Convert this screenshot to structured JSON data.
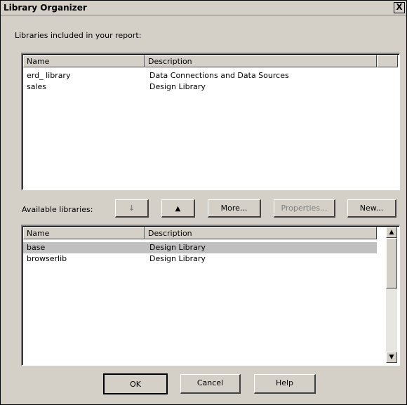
{
  "window": {
    "title": "Library Organizer",
    "close_glyph": "X"
  },
  "included": {
    "label": "Libraries included in your report:",
    "col_name": "Name",
    "col_desc": "Description",
    "rows": [
      {
        "name": "erd_ library",
        "desc": "Data Connections and Data Sources"
      },
      {
        "name": "sales",
        "desc": "Design Library"
      }
    ]
  },
  "available": {
    "label": "Available libraries:",
    "col_name": "Name",
    "col_desc": "Description",
    "rows": [
      {
        "name": "base",
        "desc": "Design Library",
        "selected": true
      },
      {
        "name": "browserlib",
        "desc": "Design Library",
        "selected": false
      }
    ]
  },
  "buttons": {
    "down_glyph": "↓",
    "up_glyph": "▲",
    "more": "More...",
    "properties": "Properties...",
    "new": "New...",
    "ok": "OK",
    "cancel": "Cancel",
    "help": "Help"
  },
  "icons": {
    "close": "close-icon",
    "down": "arrow-down-icon",
    "up": "arrow-up-icon",
    "scroll_up": "scroll-up-arrow-icon",
    "scroll_down": "scroll-down-arrow-icon"
  },
  "colors": {
    "dialog_bg": "#d4d0c8",
    "selection": "#c0c0c0"
  }
}
